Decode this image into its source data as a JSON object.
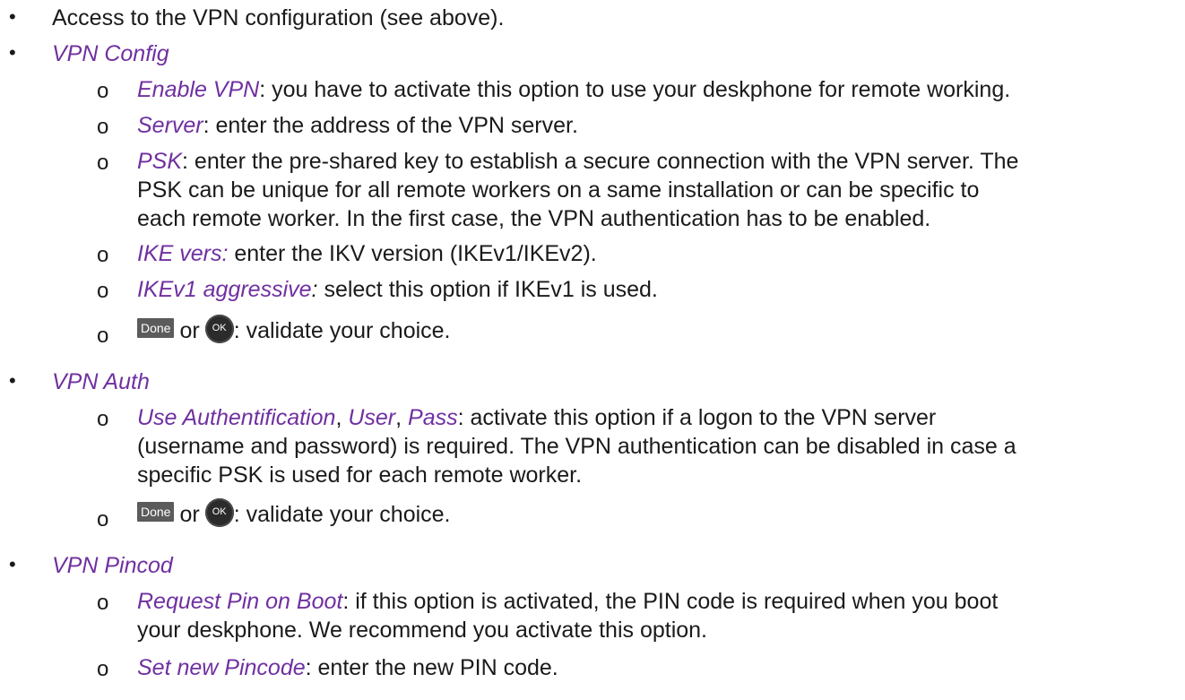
{
  "colors": {
    "italic_term": "#7030a0",
    "text": "#1a1a1a",
    "done_button_bg": "#5b5b5b",
    "ok_button_bg": "#2b2b2b"
  },
  "bullets": {
    "level1": "•",
    "level2": "o"
  },
  "icons": {
    "done": "Done",
    "ok": "OK"
  },
  "intro": {
    "text": "Access to the VPN configuration (see above)."
  },
  "vpn_config": {
    "title": "VPN Config",
    "enable": {
      "term": "Enable VPN",
      "text": ": you have to activate this option to use your deskphone for remote working."
    },
    "server": {
      "term": "Server",
      "text": ": enter the address of the VPN server."
    },
    "psk": {
      "term": "PSK",
      "line1": ": enter the pre-shared key to establish a secure connection with the VPN server. The",
      "line2": "PSK can be unique for all remote workers on a same installation or can be specific to",
      "line3": "each remote worker. In the first case, the VPN authentication has to be enabled."
    },
    "ike": {
      "term": "IKE vers:",
      "text": " enter the IKV version (IKEv1/IKEv2)."
    },
    "ikev1": {
      "term": "IKEv1 aggressive",
      "colon": ":",
      "text": " select this option if IKEv1 is used."
    },
    "validate": {
      "or": "or",
      "text": ": validate your choice."
    }
  },
  "vpn_auth": {
    "title": "VPN Auth",
    "use_auth": {
      "term1": "Use Authentification",
      "sep1": ", ",
      "term2": "User",
      "sep2": ", ",
      "term3": "Pass",
      "line1": ": activate this option if a logon to the VPN server",
      "line2": "(username and password) is required. The VPN authentication can be disabled in case a",
      "line3": "specific PSK is used for each remote worker."
    },
    "validate": {
      "or": "or",
      "text": ": validate your choice."
    }
  },
  "vpn_pincod": {
    "title": "VPN Pincod",
    "request_pin": {
      "term": "Request Pin on Boot",
      "line1": ": if this option is activated, the PIN code is required when you boot",
      "line2": "your deskphone. We recommend you activate this option."
    },
    "set_pin": {
      "term": "Set new Pincode",
      "text": ": enter the new PIN code."
    }
  }
}
